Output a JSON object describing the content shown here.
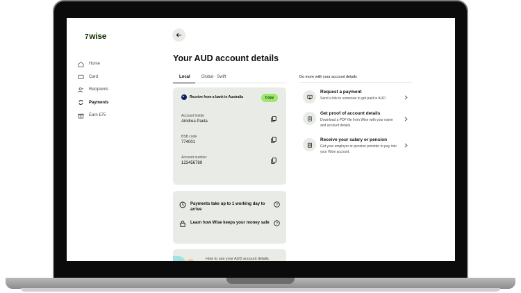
{
  "app": {
    "logo_text": "wise",
    "logo_flag": "7"
  },
  "sidebar": {
    "items": [
      {
        "label": "Home",
        "icon": "home-icon"
      },
      {
        "label": "Card",
        "icon": "card-icon"
      },
      {
        "label": "Recipients",
        "icon": "recipients-icon"
      },
      {
        "label": "Payments",
        "icon": "payments-icon",
        "active": true
      },
      {
        "label": "Earn £75",
        "icon": "gift-icon"
      }
    ]
  },
  "main": {
    "title": "Your AUD account details",
    "tabs": [
      {
        "label": "Local",
        "active": true
      },
      {
        "label": "Global · Swift"
      }
    ],
    "receive_label": "Receive from a bank in Australia",
    "copy_label": "Copy",
    "fields": [
      {
        "label": "Account holder",
        "value": "Aindrea Paula"
      },
      {
        "label": "BSB code",
        "value": "774001"
      },
      {
        "label": "Account number",
        "value": "123456789"
      }
    ],
    "info": [
      {
        "text": "Payments take up to 1 working day to arrive"
      },
      {
        "text": "Learn how Wise keeps your money safe"
      }
    ],
    "howto_text": "How to use your AUD account details"
  },
  "more": {
    "title": "Do more with your account details",
    "items": [
      {
        "title": "Request a payment",
        "desc": "Send a link to someone to get paid in AUD",
        "icon": "request-icon"
      },
      {
        "title": "Get proof of account details",
        "desc": "Download a PDF file from Wise with your name and account details.",
        "icon": "document-icon"
      },
      {
        "title": "Receive your salary or pension",
        "desc": "Get your employer or pension provider to pay into your Wise account.",
        "icon": "bank-icon"
      }
    ]
  },
  "colors": {
    "brand_green": "#9fe870",
    "forest": "#163300",
    "card_bg": "#e8ebe6"
  }
}
